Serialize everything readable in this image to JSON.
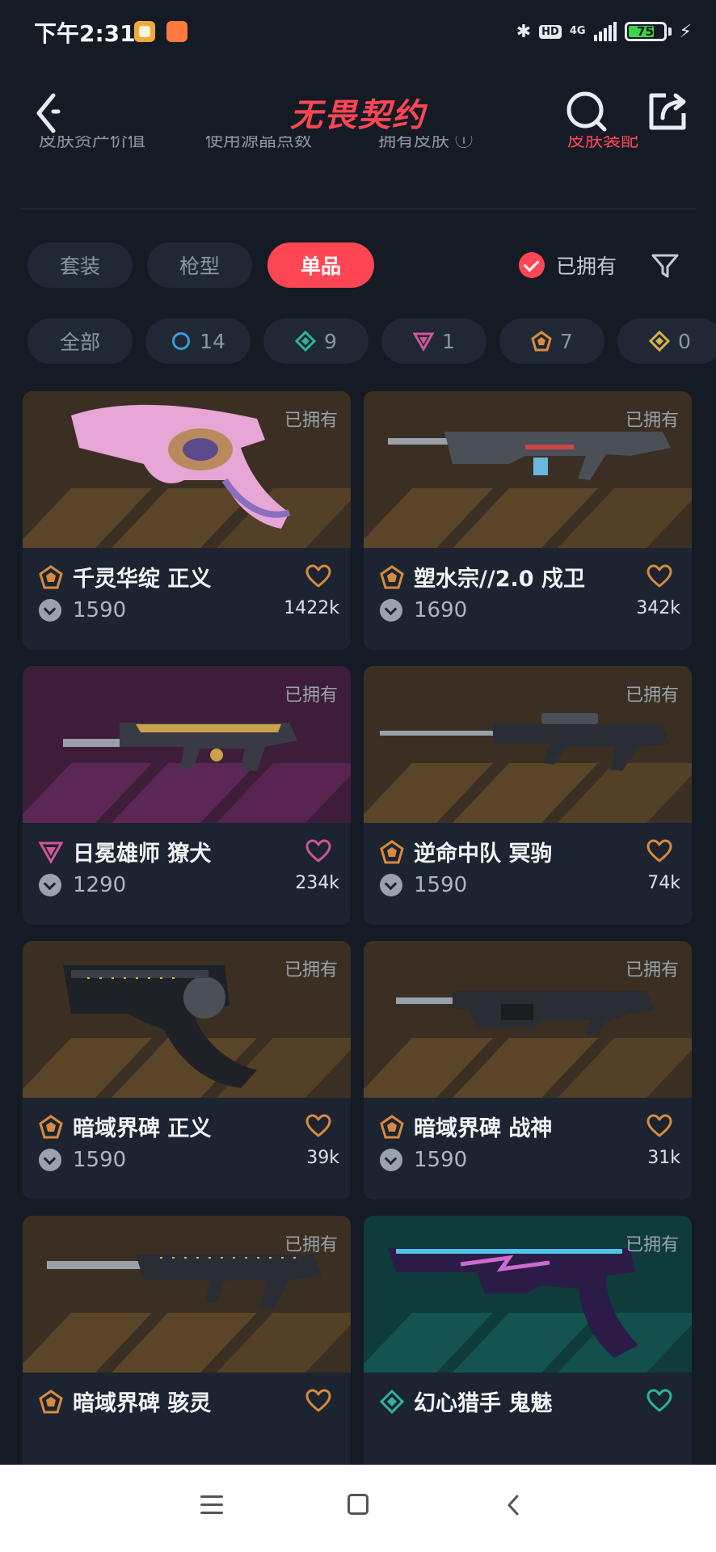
{
  "status_bar": {
    "time": "下午2:31",
    "network": "4G",
    "hd": "HD",
    "battery": "75"
  },
  "header": {
    "brand": "无畏契约"
  },
  "top_tabs": [
    "皮肤资产价值",
    "使用源晶点数",
    "拥有皮肤 ⓘ",
    "皮肤装配"
  ],
  "segments": {
    "items": [
      "套装",
      "枪型",
      "单品"
    ],
    "active": 2
  },
  "owned_filter": {
    "label": "已拥有",
    "checked": true
  },
  "tier_chips": [
    {
      "label": "全部"
    },
    {
      "label": "14",
      "color": "#3a9bd9",
      "icon": "circle-tier-icon"
    },
    {
      "label": "9",
      "color": "#2fb39a",
      "icon": "diamond-tier-icon"
    },
    {
      "label": "1",
      "color": "#d0559a",
      "icon": "triangle-tier-icon"
    },
    {
      "label": "7",
      "color": "#d88a3e",
      "icon": "pentagon-tier-icon"
    },
    {
      "label": "0",
      "color": "#d9b04a",
      "icon": "diamond-gold-tier-icon"
    }
  ],
  "cards": [
    {
      "name": "千灵华绽 正义",
      "price": "1590",
      "likes": "1422k",
      "owned": "已拥有",
      "tier": "pentagon",
      "tier_color": "#d88a3e",
      "bg": "orange",
      "gun": "pink-revolver"
    },
    {
      "name": "塑水宗//2.0 戍卫",
      "price": "1690",
      "likes": "342k",
      "owned": "已拥有",
      "tier": "pentagon",
      "tier_color": "#d88a3e",
      "bg": "orange",
      "gun": "rifle"
    },
    {
      "name": "日冕雄师 獠犬",
      "price": "1290",
      "likes": "234k",
      "owned": "已拥有",
      "tier": "triangle",
      "tier_color": "#d0559a",
      "bg": "purple",
      "gun": "gold-smg"
    },
    {
      "name": "逆命中队 冥驹",
      "price": "1590",
      "likes": "74k",
      "owned": "已拥有",
      "tier": "pentagon",
      "tier_color": "#d88a3e",
      "bg": "orange",
      "gun": "sniper"
    },
    {
      "name": "暗域界碑 正义",
      "price": "1590",
      "likes": "39k",
      "owned": "已拥有",
      "tier": "pentagon",
      "tier_color": "#d88a3e",
      "bg": "orange",
      "gun": "black-revolver"
    },
    {
      "name": "暗域界碑 战神",
      "price": "1590",
      "likes": "31k",
      "owned": "已拥有",
      "tier": "pentagon",
      "tier_color": "#d88a3e",
      "bg": "orange",
      "gun": "black-rifle"
    },
    {
      "name": "暗域界碑 骇灵",
      "price": "",
      "likes": "",
      "owned": "已拥有",
      "tier": "pentagon",
      "tier_color": "#d88a3e",
      "bg": "orange",
      "gun": "black-smg"
    },
    {
      "name": "幻心猎手 鬼魅",
      "price": "",
      "likes": "",
      "owned": "已拥有",
      "tier": "diamond",
      "tier_color": "#2fb39a",
      "bg": "teal",
      "gun": "neon-pistol"
    }
  ]
}
